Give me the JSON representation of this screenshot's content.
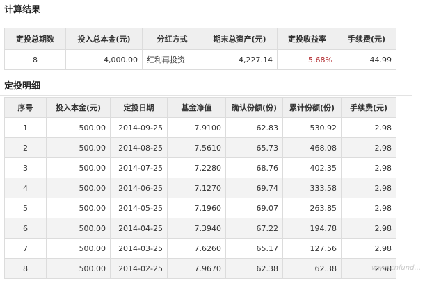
{
  "summary": {
    "title": "计算结果",
    "headers": [
      "定投总期数",
      "投入总本金(元)",
      "分红方式",
      "期末总资产(元)",
      "定投收益率",
      "手续费(元)"
    ],
    "row": {
      "periods": "8",
      "principal": "4,000.00",
      "dividend_method": "红利再投资",
      "final_assets": "4,227.14",
      "return_rate": "5.68%",
      "fees": "44.99"
    },
    "rate_color": "#b0272b"
  },
  "detail": {
    "title": "定投明细",
    "headers": [
      "序号",
      "投入本金(元)",
      "定投日期",
      "基金净值",
      "确认份额(份)",
      "累计份额(份)",
      "手续费(元)"
    ],
    "rows": [
      [
        "1",
        "500.00",
        "2014-09-25",
        "7.9100",
        "62.83",
        "530.92",
        "2.98"
      ],
      [
        "2",
        "500.00",
        "2014-08-25",
        "7.5610",
        "65.73",
        "468.08",
        "2.98"
      ],
      [
        "3",
        "500.00",
        "2014-07-25",
        "7.2280",
        "68.76",
        "402.35",
        "2.98"
      ],
      [
        "4",
        "500.00",
        "2014-06-25",
        "7.1270",
        "69.74",
        "333.58",
        "2.98"
      ],
      [
        "5",
        "500.00",
        "2014-05-25",
        "7.1960",
        "69.07",
        "263.85",
        "2.98"
      ],
      [
        "6",
        "500.00",
        "2014-04-25",
        "7.3940",
        "67.22",
        "194.78",
        "2.98"
      ],
      [
        "7",
        "500.00",
        "2014-03-25",
        "7.6260",
        "65.17",
        "127.56",
        "2.98"
      ],
      [
        "8",
        "500.00",
        "2014-02-25",
        "7.9670",
        "62.38",
        "62.38",
        "2.98"
      ]
    ]
  },
  "watermark": "www.cnfund..."
}
